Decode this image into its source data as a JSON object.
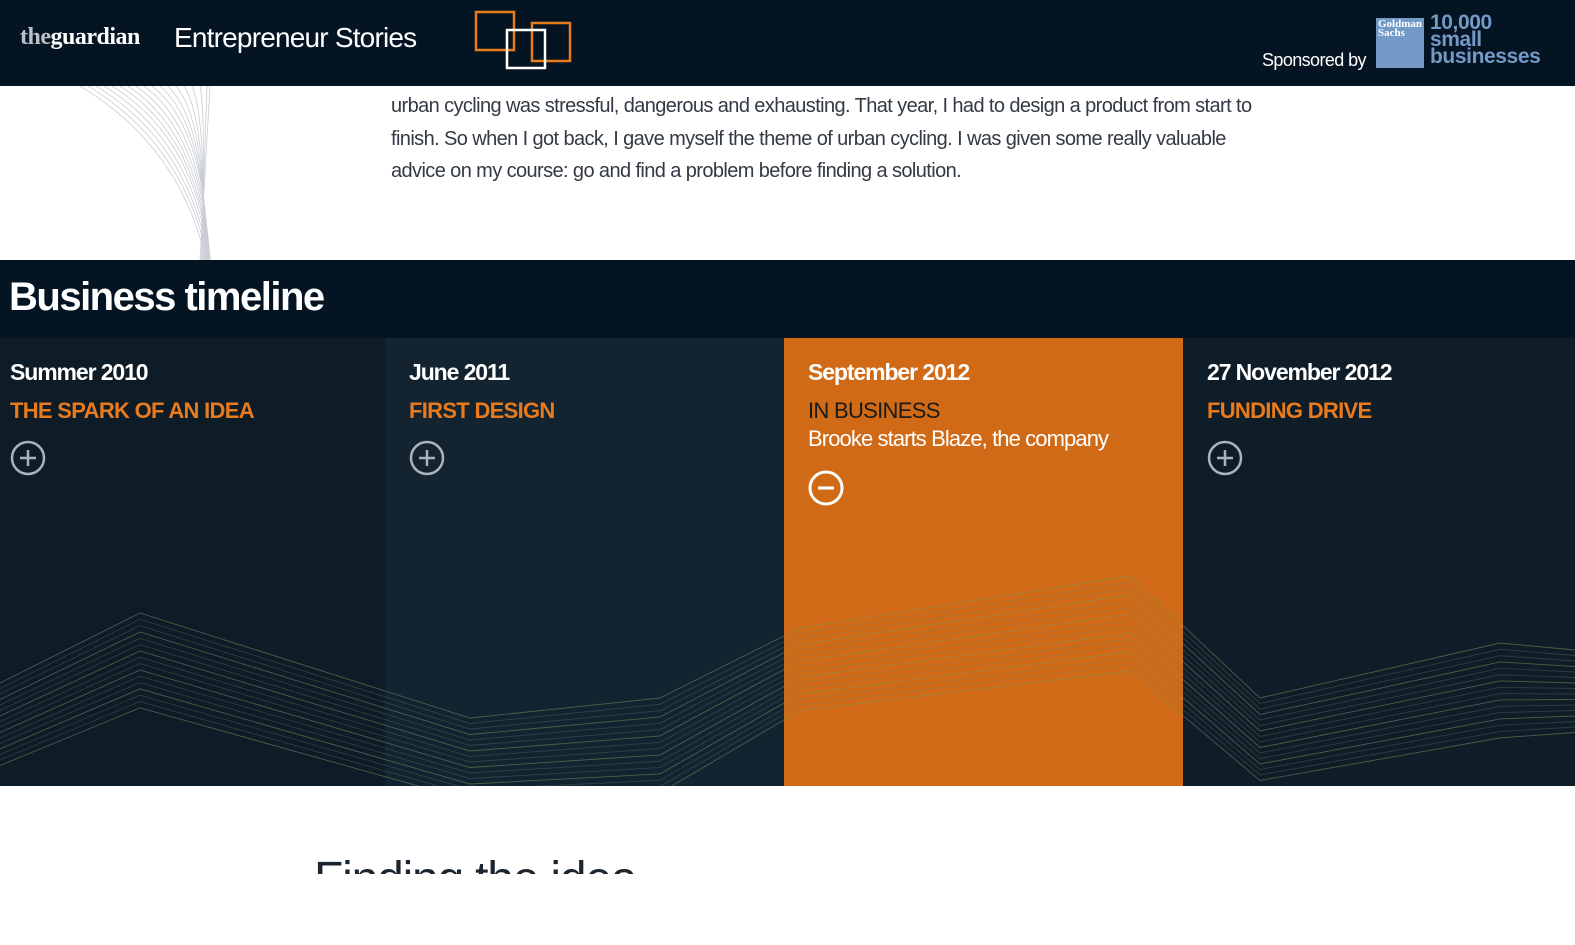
{
  "header": {
    "logo_the": "the",
    "logo_guardian": "guardian",
    "section_title": "Entrepreneur Stories",
    "sponsored_by": "Sponsored by",
    "sponsor_logo_text": "Goldman Sachs",
    "sponsor_program": [
      "10,000",
      "small",
      "businesses"
    ]
  },
  "intro": {
    "paragraph": "urban cycling was stressful, dangerous and exhausting. That year, I had to design a product from start to finish. So when I got back, I gave myself the theme of urban cycling. I was given some really valuable advice on my course: go and find a problem before finding a solution."
  },
  "timeline": {
    "title": "Business timeline",
    "items": [
      {
        "date": "Summer 2010",
        "title": "THE SPARK OF AN IDEA",
        "desc": "",
        "icon": "plus-circle-icon"
      },
      {
        "date": "June 2011",
        "title": "FIRST DESIGN",
        "desc": "",
        "icon": "plus-circle-icon"
      },
      {
        "date": "September 2012",
        "title": "IN BUSINESS",
        "desc": "Brooke starts Blaze, the company",
        "icon": "minus-circle-icon"
      },
      {
        "date": "27 November 2012",
        "title": "FUNDING DRIVE",
        "desc": "",
        "icon": "plus-circle-icon"
      }
    ]
  },
  "next_section": {
    "heading": "Finding the idea"
  },
  "colors": {
    "navy": "#051422",
    "orange": "#d06a16",
    "accent_orange": "#e87b1d",
    "sponsor_blue": "#7399c6"
  }
}
